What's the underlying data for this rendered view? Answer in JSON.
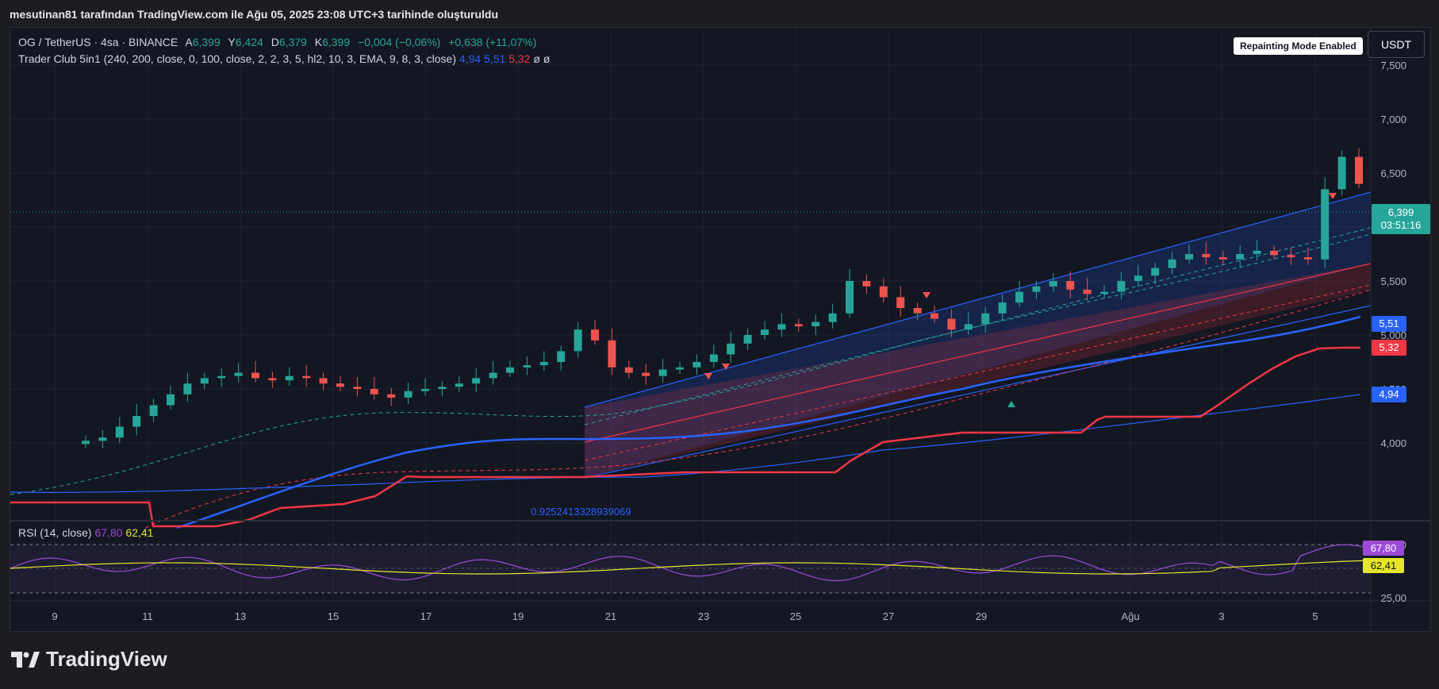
{
  "caption": "mesutinan81 tarafından TradingView.com ile Ağu 05, 2025 23:08 UTC+3 tarihinde oluşturuldu",
  "symbol": {
    "name": "OG / TetherUS · 4sa · BINANCE",
    "open_label": "A",
    "open": "6,399",
    "high_label": "Y",
    "high": "6,424",
    "low_label": "D",
    "low": "6,379",
    "close_label": "K",
    "close": "6,399",
    "change": "−0,004 (−0,06%)",
    "change2": "+0,638 (+11,07%)"
  },
  "indicator": {
    "label": "Trader Club 5in1 (240, 200, close, 0, 100, close, 2, 2, 3, 5, hl2, 10, 3, EMA, 9, 8, 3, close)",
    "v1": "4,94",
    "v2": "5,51",
    "v3": "5,32",
    "v4": "ø",
    "v5": "ø"
  },
  "rsi": {
    "label": "RSI (14, close)",
    "value": "67,80",
    "ma": "62,41"
  },
  "badges": {
    "repaint": "Repainting Mode Enabled",
    "currency": "USDT"
  },
  "price_labels": {
    "last": "6,399",
    "countdown": "03:51:16",
    "line_blue": "5,51",
    "line_red": "5,32",
    "line_thin": "4,94"
  },
  "channel_text": "0.9252413328939069",
  "logo": "TradingView",
  "colors": {
    "up": "#26a69a",
    "down": "#ef5350",
    "blue": "#2962ff",
    "red": "#f23645",
    "rsi": "#9c4bd6",
    "rsi_ma": "#e6e62a"
  },
  "chart_data": {
    "type": "candlestick",
    "y_ticks": [
      "7,500",
      "7,000",
      "6,500",
      "6,000",
      "5,500",
      "5,000",
      "4,500",
      "4,000"
    ],
    "ylim": [
      4.0,
      7.5
    ],
    "x_ticks": [
      "9",
      "11",
      "13",
      "15",
      "17",
      "19",
      "21",
      "23",
      "25",
      "27",
      "29",
      "Ağu",
      "3",
      "5"
    ],
    "rsi_ticks": [
      "75,00",
      "25,00"
    ],
    "approx_closes": [
      4.02,
      4.05,
      4.15,
      4.25,
      4.35,
      4.45,
      4.55,
      4.6,
      4.62,
      4.65,
      4.6,
      4.58,
      4.62,
      4.6,
      4.55,
      4.52,
      4.5,
      4.45,
      4.42,
      4.48,
      4.5,
      4.52,
      4.55,
      4.6,
      4.65,
      4.7,
      4.72,
      4.75,
      4.85,
      5.05,
      4.95,
      4.7,
      4.65,
      4.62,
      4.68,
      4.7,
      4.75,
      4.82,
      4.92,
      5.0,
      5.05,
      5.1,
      5.08,
      5.12,
      5.2,
      5.5,
      5.45,
      5.35,
      5.25,
      5.2,
      5.15,
      5.05,
      5.1,
      5.2,
      5.3,
      5.4,
      5.45,
      5.5,
      5.42,
      5.38,
      5.4,
      5.5,
      5.55,
      5.62,
      5.7,
      5.75,
      5.72,
      5.7,
      5.75,
      5.78,
      5.74,
      5.72,
      5.7,
      6.35,
      6.65,
      6.4
    ]
  }
}
